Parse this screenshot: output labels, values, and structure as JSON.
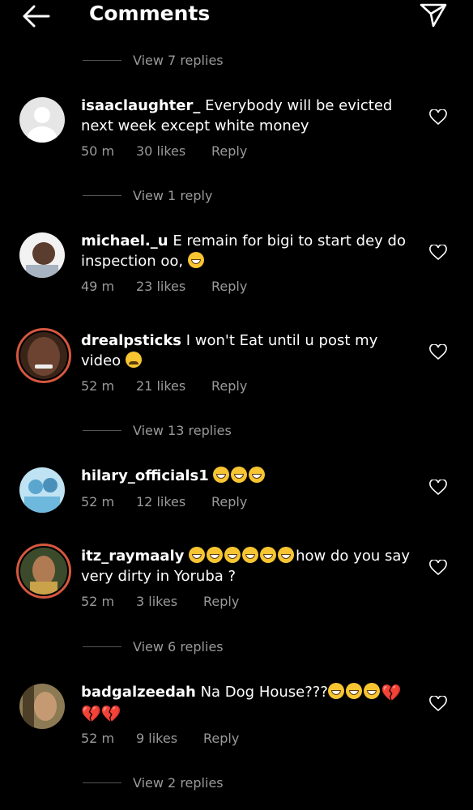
{
  "header": {
    "title": "Comments"
  },
  "view_replies": [
    "View 7 replies",
    "View 1 reply",
    "View 13 replies",
    "View 6 replies",
    "View 2 replies"
  ],
  "comments": [
    {
      "user": "isaaclaughter_",
      "text": "Everybody will be evicted next week except white money",
      "time": "50 m",
      "likes": "30 likes",
      "reply": "Reply"
    },
    {
      "user": "michael._u",
      "text": "E remain for bigi to start dey do inspection oo,",
      "time": "49 m",
      "likes": "23 likes",
      "reply": "Reply"
    },
    {
      "user": "drealpsticks",
      "text": "I won't Eat until u post my video",
      "time": "52 m",
      "likes": "21 likes",
      "reply": "Reply"
    },
    {
      "user": "hilary_officials1",
      "text": "",
      "time": "52 m",
      "likes": "12 likes",
      "reply": "Reply"
    },
    {
      "user": "itz_raymaaly",
      "text": "how do you say very dirty in Yoruba ?",
      "time": "52 m",
      "likes": "3 likes",
      "reply": "Reply"
    },
    {
      "user": "badgalzeedah",
      "text": "Na Dog House???",
      "time": "52 m",
      "likes": "9 likes",
      "reply": "Reply"
    }
  ],
  "icons": {
    "back": "arrow-left-icon",
    "send": "send-icon",
    "like": "heart-outline-icon"
  },
  "colors": {
    "background": "#000000",
    "meta": "#9a9a9a",
    "story_ring": "#d4573e"
  }
}
